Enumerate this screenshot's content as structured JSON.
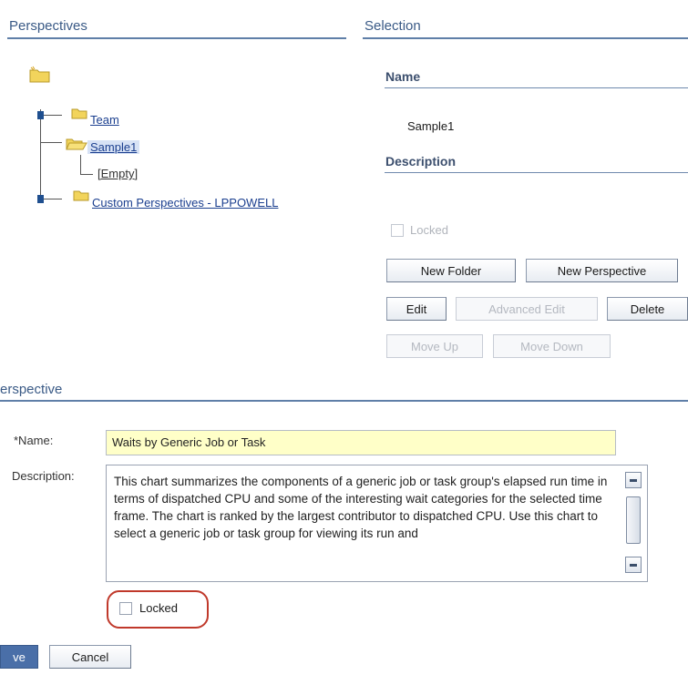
{
  "perspectives": {
    "title": "Perspectives",
    "tree": {
      "items": [
        {
          "label": "Team"
        },
        {
          "label": "Sample1"
        },
        {
          "label": "[Empty]"
        },
        {
          "label": "Custom Perspectives - LPPOWELL"
        }
      ]
    }
  },
  "selection": {
    "title": "Selection",
    "name_heading": "Name",
    "name_value": "Sample1",
    "description_heading": "Description",
    "locked_label": "Locked",
    "buttons": {
      "new_folder": "New Folder",
      "new_perspective": "New Perspective",
      "edit": "Edit",
      "advanced_edit": "Advanced Edit",
      "delete": "Delete",
      "move_up": "Move Up",
      "move_down": "Move Down"
    }
  },
  "perspective": {
    "title": "erspective",
    "name_label": "*Name:",
    "name_value": "Waits by Generic Job or Task",
    "description_label": "Description:",
    "description_value": "This chart summarizes the components of a generic job or task group's elapsed run time in terms of dispatched CPU and some of the interesting wait categories for the selected time frame. The chart is ranked by the largest contributor to dispatched CPU. Use this chart to select a generic job or task group for viewing its run and",
    "locked_label": "Locked",
    "save_label": "ve",
    "cancel_label": "Cancel"
  },
  "colors": {
    "section_rule": "#5f7fa8",
    "link": "#1b3f8f",
    "name_input_bg": "#ffffc8",
    "highlight": "#c0392b"
  }
}
